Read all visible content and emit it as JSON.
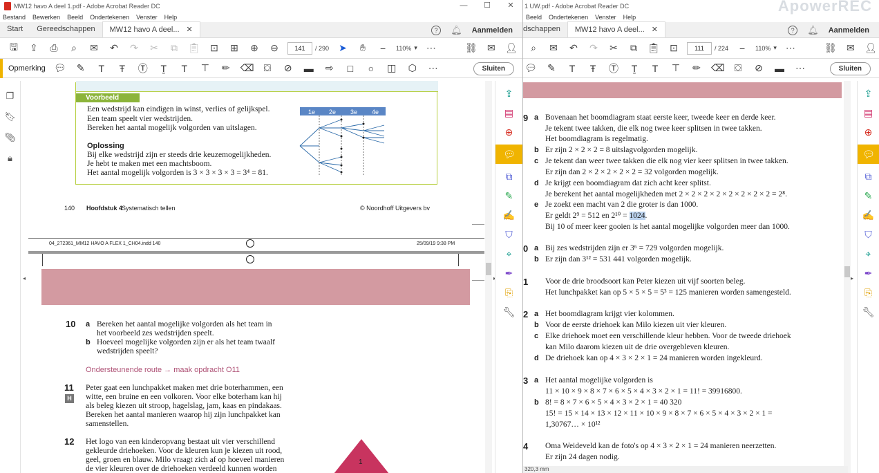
{
  "left": {
    "title": "MW12 havo A deel 1.pdf - Adobe Acrobat Reader DC",
    "menu": [
      "Bestand",
      "Bewerken",
      "Beeld",
      "Ondertekenen",
      "Venster",
      "Help"
    ],
    "tabs": {
      "start": "Start",
      "tools": "Gereedschappen",
      "doc": "MW12 havo A deel..."
    },
    "login": "Aanmelden",
    "page_current": "141",
    "page_total": "/ 290",
    "zoom": "110%",
    "comment_label": "Opmerking",
    "close": "Sluiten",
    "example": {
      "head": "Voorbeeld",
      "lines": [
        "Een wedstrijd kan eindigen in winst, verlies of gelijkspel.",
        "Een team speelt vier wedstrijden.",
        "Bereken het aantal mogelijk volgorden van uitslagen."
      ],
      "solution_head": "Oplossing",
      "solution": [
        "Bij elke wedstrijd zijn er steeds drie keuzemogelijkheden.",
        "Je hebt te maken met een machtsboom.",
        "Het aantal mogelijk volgorden is 3 × 3 × 3 × 3 = 3⁴ = 81."
      ],
      "tree_headers": [
        "1e",
        "2e",
        "3e",
        "4e"
      ]
    },
    "page_footer": {
      "page": "140",
      "chapter": "Hoofdstuk 4",
      "chapter_title": "Systematisch tellen",
      "copyright": "© Noordhoff Uitgevers bv"
    },
    "indd": {
      "file": "04_272361_MM12 HAVO A FLEX 1_CH04.indd   140",
      "date": "25/09/19   9:38 PM"
    },
    "q10": {
      "num": "10",
      "a": "Bereken het aantal mogelijke volgorden als het team in",
      "a2": "het voorbeeld zes wedstrijden speelt.",
      "b": "Hoeveel mogelijke volgorden zijn er als het team twaalf",
      "b2": "wedstrijden speelt?"
    },
    "route": "Ondersteunende route → maak opdracht O11",
    "q11": {
      "num": "11",
      "badge": "H",
      "lines": [
        "Peter gaat een lunchpakket maken met drie boterhammen, een",
        "witte, een bruine en een volkoren. Voor elke boterham kan hij",
        "als beleg kiezen uit stroop, hagelslag, jam, kaas en pindakaas.",
        "Bereken het aantal manieren waarop hij zijn lunchpakket kan",
        "samenstellen."
      ]
    },
    "q12": {
      "num": "12",
      "lines": [
        "Het logo van een kinderopvang bestaat uit vier verschillend",
        "gekleurde driehoeken. Voor de kleuren kun je kiezen uit rood,",
        "geel, groen en blauw. Milo vraagt zich af op hoeveel manieren",
        "de vier kleuren over de driehoeken verdeeld kunnen worden"
      ]
    },
    "triangle_label": "1"
  },
  "right": {
    "title": "1 UW.pdf - Adobe Acrobat Reader DC",
    "watermark": "ApowerREC",
    "menu": [
      "Beeld",
      "Ondertekenen",
      "Venster",
      "Help"
    ],
    "tabs": {
      "tools": "dschappen",
      "doc": "MW12 havo A deel..."
    },
    "login": "Aanmelden",
    "page_current": "111",
    "page_total": "/ 224",
    "zoom": "110%",
    "close": "Sluiten",
    "answers": [
      {
        "n": "9",
        "l": "a",
        "t": "Bovenaan het boomdiagram staat eerste keer, tweede keer en derde keer."
      },
      {
        "n": "",
        "l": "",
        "t": "Je tekent twee takken, die elk nog twee keer splitsen in twee takken."
      },
      {
        "n": "",
        "l": "",
        "t": "Het boomdiagram is regelmatig."
      },
      {
        "n": "",
        "l": "b",
        "t": "Er zijn 2 × 2 × 2 = 8 uitslagvolgorden mogelijk."
      },
      {
        "n": "",
        "l": "c",
        "t": "Je tekent dan weer twee takken die elk nog vier keer splitsen in twee takken."
      },
      {
        "n": "",
        "l": "",
        "t": "Er zijn dan 2 × 2 × 2 × 2 × 2 = 32 volgorden mogelijk."
      },
      {
        "n": "",
        "l": "d",
        "t": "Je krijgt een boomdiagram dat zich acht keer splitst."
      },
      {
        "n": "",
        "l": "",
        "t": "Je berekent het aantal mogelijkheden met 2 × 2 × 2 × 2 × 2 × 2 × 2 × 2 = 2⁸."
      },
      {
        "n": "",
        "l": "e",
        "t": "Je zoekt een macht van 2 die groter is dan 1000."
      },
      {
        "n": "",
        "l": "",
        "t": "Er geldt 2⁹ = 512 en 2¹⁰ = ",
        "hl": "1024",
        "after": "."
      },
      {
        "n": "",
        "l": "",
        "t": "Bij 10 of meer keer gooien is het aantal mogelijke volgorden meer dan 1000."
      },
      {
        "n": "0",
        "l": "a",
        "t": "Bij zes wedstrijden zijn er 3⁶ = 729 volgorden mogelijk."
      },
      {
        "n": "",
        "l": "b",
        "t": "Er zijn dan 3¹² = 531 441 volgorden mogelijk."
      },
      {
        "n": "1",
        "l": "",
        "t": "Voor de drie broodsoort kan Peter kiezen uit vijf soorten beleg."
      },
      {
        "n": "",
        "l": "",
        "t": "Het lunchpakket kan op 5 × 5 × 5 = 5³ = 125 manieren worden samengesteld."
      },
      {
        "n": "2",
        "l": "a",
        "t": "Het boomdiagram krijgt vier kolommen."
      },
      {
        "n": "",
        "l": "b",
        "t": "Voor de eerste driehoek kan Milo kiezen uit vier kleuren."
      },
      {
        "n": "",
        "l": "c",
        "t": "Elke driehoek moet een verschillende kleur hebben. Voor de tweede driehoek"
      },
      {
        "n": "",
        "l": "",
        "t": "kan Milo daarom kiezen uit de drie overgebleven kleuren."
      },
      {
        "n": "",
        "l": "d",
        "t": "De driehoek kan op 4 × 3 × 2 × 1 = 24 manieren worden ingekleurd."
      },
      {
        "n": "3",
        "l": "a",
        "t": "Het aantal mogelijke volgorden is"
      },
      {
        "n": "",
        "l": "",
        "t": "11 × 10 × 9 × 8 × 7 × 6 × 5 × 4 × 3 × 2 × 1 = 11! = 39916800."
      },
      {
        "n": "",
        "l": "b",
        "t": "8! = 8 × 7 × 6 × 5 × 4 × 3 × 2 × 1 = 40 320"
      },
      {
        "n": "",
        "l": "",
        "t": "15! = 15 × 14 × 13 × 12 × 11 × 10 × 9 × 8 × 7 × 6 × 5 × 4 × 3 × 2 × 1 ="
      },
      {
        "n": "",
        "l": "",
        "t": "1,30767… × 10¹²"
      },
      {
        "n": "4",
        "l": "",
        "t": "Oma Weideveld kan de foto's op 4 × 3 × 2 × 1 = 24 manieren neerzetten."
      },
      {
        "n": "",
        "l": "",
        "t": "Er zijn 24 dagen nodig."
      }
    ],
    "status": "320,3 mm"
  },
  "colors": {
    "pink": "#d39aa1",
    "accent_yellow": "#f0b400",
    "green": "#8cb43a",
    "pdf_red": "#d62b1f"
  }
}
